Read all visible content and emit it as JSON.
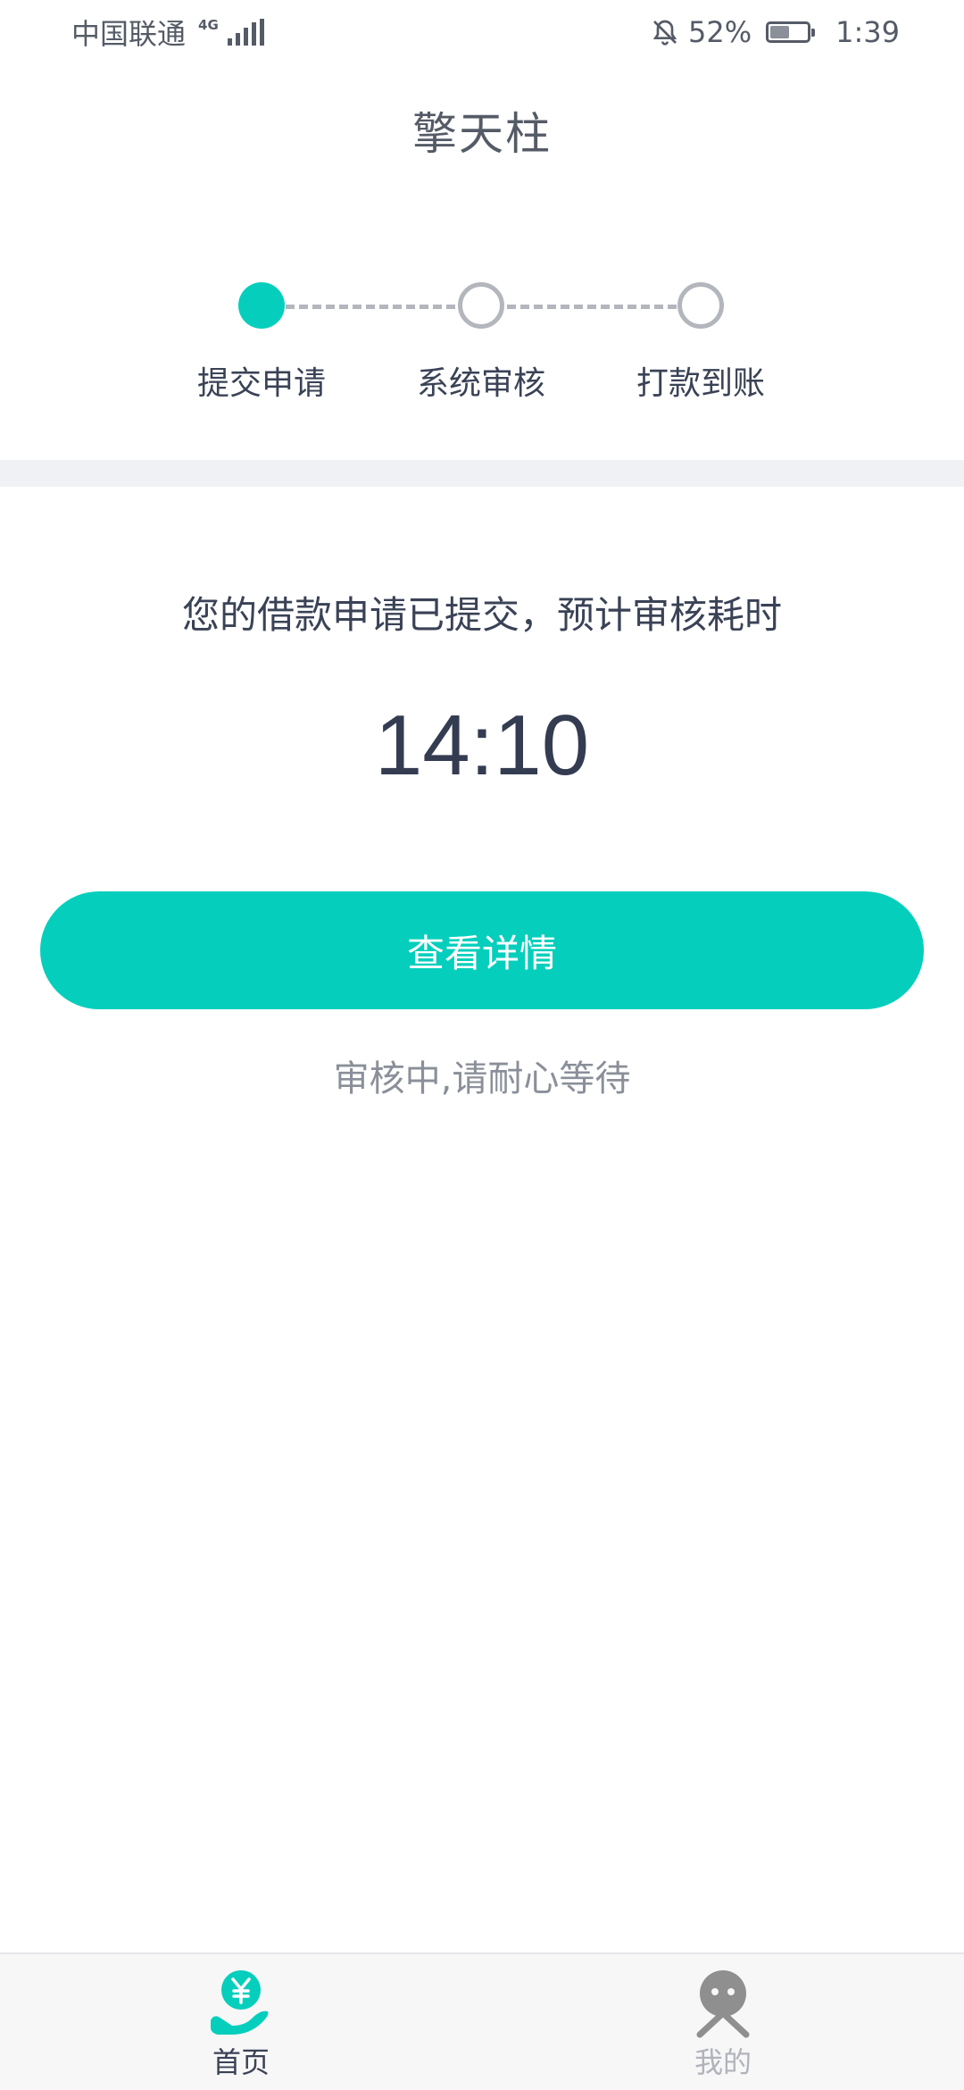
{
  "status_bar": {
    "carrier": "中国联通",
    "network": "4G",
    "battery_percent": "52%",
    "battery_level": 0.52,
    "time": "1:39",
    "icons": [
      "signal-icon",
      "bell-off-icon",
      "battery-icon"
    ]
  },
  "header": {
    "title": "擎天柱"
  },
  "stepper": {
    "steps": [
      {
        "label": "提交申请",
        "state": "active"
      },
      {
        "label": "系统审核",
        "state": "inactive"
      },
      {
        "label": "打款到账",
        "state": "inactive"
      }
    ]
  },
  "main": {
    "notice": "您的借款申请已提交，预计审核耗时",
    "countdown": "14:10",
    "details_button": "查看详情",
    "status_text": "审核中,请耐心等待"
  },
  "bottom_nav": {
    "items": [
      {
        "label": "首页",
        "icon": "yen-hand-icon",
        "active": true
      },
      {
        "label": "我的",
        "icon": "profile-icon",
        "active": false
      }
    ]
  },
  "colors": {
    "accent": "#05cfbc",
    "text_primary": "#3a4256",
    "text_secondary": "#8a8f99",
    "inactive": "#b3b6bd"
  }
}
